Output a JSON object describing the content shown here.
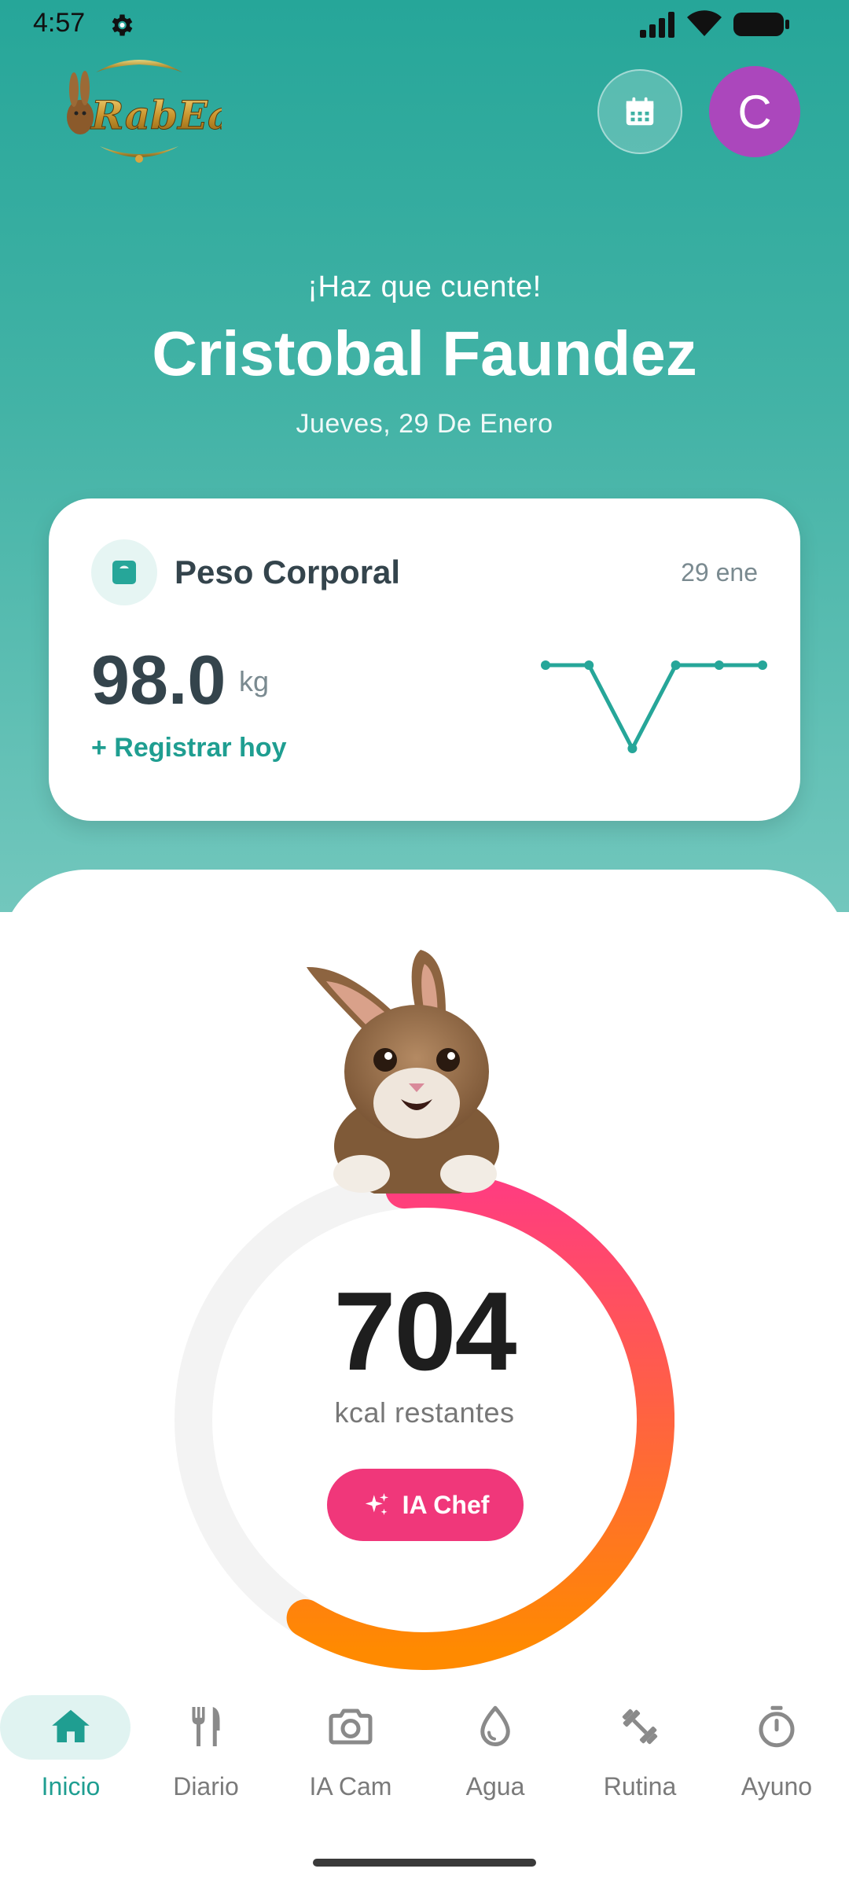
{
  "status_bar": {
    "time": "4:57"
  },
  "header": {
    "logo_text": "RabEat",
    "avatar_letter": "C"
  },
  "greeting": {
    "subtitle": "¡Haz que cuente!",
    "name": "Cristobal Faundez",
    "date": "Jueves, 29 De Enero"
  },
  "weight_card": {
    "title": "Peso Corporal",
    "date": "29 ene",
    "value": "98.0",
    "unit": "kg",
    "register_label": "+ Registrar hoy",
    "trend": [
      98.0,
      98.0,
      97.5,
      98.0,
      98.0,
      98.0
    ]
  },
  "calories": {
    "remaining": "704",
    "label": "kcal restantes",
    "progress_fraction": 0.6
  },
  "chef_button": {
    "label": "IA Chef"
  },
  "nav": {
    "items": [
      {
        "label": "Inicio",
        "icon": "home-icon",
        "active": true
      },
      {
        "label": "Diario",
        "icon": "fork-knife-icon",
        "active": false
      },
      {
        "label": "IA Cam",
        "icon": "camera-icon",
        "active": false
      },
      {
        "label": "Agua",
        "icon": "water-drop-icon",
        "active": false
      },
      {
        "label": "Rutina",
        "icon": "dumbbell-icon",
        "active": false
      },
      {
        "label": "Ayuno",
        "icon": "stopwatch-icon",
        "active": false
      }
    ]
  },
  "colors": {
    "teal": "#26a699",
    "accent_pink": "#f0377a",
    "ring_start": "#ff3d7f",
    "ring_end": "#ff8a00",
    "avatar": "#ab47bc"
  }
}
